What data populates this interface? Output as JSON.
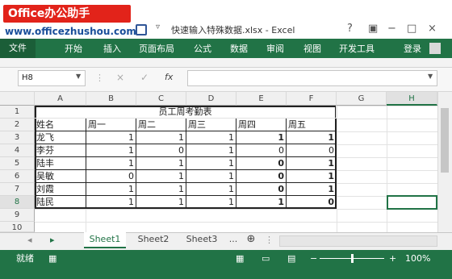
{
  "watermark": {
    "text": "Office办公助手",
    "url": "www.officezhushou.com"
  },
  "window": {
    "title": "快速输入特殊数据.xlsx - Excel",
    "help": "?",
    "minimize": "−",
    "restore": "□",
    "close": "×"
  },
  "ribbon": {
    "tabs": [
      "文件",
      "开始",
      "插入",
      "页面布局",
      "公式",
      "数据",
      "审阅",
      "视图",
      "开发工具"
    ],
    "login": "登录"
  },
  "formula_bar": {
    "name_box": "H8",
    "cancel": "×",
    "enter": "✓",
    "fx": "fx",
    "value": ""
  },
  "columns": [
    "A",
    "B",
    "C",
    "D",
    "E",
    "F",
    "G",
    "H"
  ],
  "rows": [
    "1",
    "2",
    "3",
    "4",
    "5",
    "6",
    "7",
    "8",
    "9",
    "10"
  ],
  "table": {
    "title": "员工周考勤表",
    "headers": [
      "姓名",
      "周一",
      "周二",
      "周三",
      "周四",
      "周五"
    ],
    "data": [
      [
        "龙飞",
        "1",
        "1",
        "1",
        "1",
        "1"
      ],
      [
        "李芬",
        "1",
        "0",
        "1",
        "0",
        "0"
      ],
      [
        "陆丰",
        "1",
        "1",
        "1",
        "0",
        "1"
      ],
      [
        "吴敏",
        "0",
        "1",
        "1",
        "0",
        "1"
      ],
      [
        "刘霞",
        "1",
        "1",
        "1",
        "0",
        "1"
      ],
      [
        "陆民",
        "1",
        "1",
        "1",
        "1",
        "0"
      ]
    ]
  },
  "sheets": {
    "tabs": [
      "Sheet1",
      "Sheet2",
      "Sheet3"
    ],
    "more": "...",
    "add": "⊕",
    "active": "Sheet1"
  },
  "status": {
    "ready": "就绪",
    "zoom": "100%",
    "zoom_minus": "−",
    "zoom_plus": "+"
  }
}
